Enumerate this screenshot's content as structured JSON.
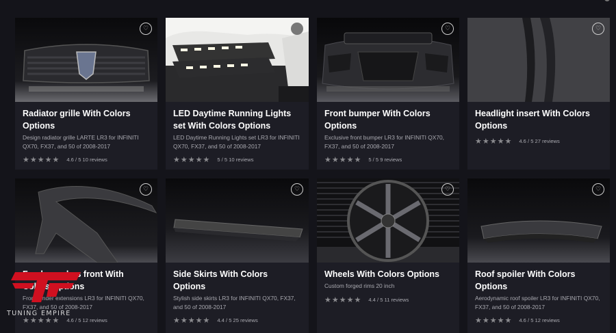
{
  "products": [
    {
      "title": "Radiator grille With Colors Options",
      "desc": "Design radiator grille LARTE LR3 for INFINITI QX70, FX37, and 50 of 2008-2017",
      "stars": "★★★★★",
      "rating": "4.6 / 5 10 reviews"
    },
    {
      "title": "LED Daytime Running Lights set With Colors Options",
      "desc": "LED Daytime Running Lights set LR3 for INFINITI QX70, FX37, and 50 of 2008-2017",
      "stars": "★★★★★",
      "rating": "5 / 5 10 reviews"
    },
    {
      "title": "Front bumper With Colors Options",
      "desc": "Exclusive front bumper LR3 for INFINITI QX70, FX37, and 50 of 2008-2017",
      "stars": "★★★★★",
      "rating": "5 / 5 9 reviews"
    },
    {
      "title": "Headlight insert With Colors Options",
      "desc": "",
      "stars": "★★★★★",
      "rating": "4.6 / 5 27 reviews"
    },
    {
      "title": "Fender arches front With Colors Options",
      "desc": "Front fender extensions LR3 for INFINITI QX70, FX37, and 50 of 2008-2017",
      "stars": "★★★★★",
      "rating": "4.6 / 5 12 reviews"
    },
    {
      "title": "Side Skirts With Colors Options",
      "desc": "Stylish side skirts LR3 for INFINITI QX70, FX37, and 50 of 2008-2017",
      "stars": "★★★★★",
      "rating": "4.4 / 5 25 reviews"
    },
    {
      "title": "Wheels With Colors Options",
      "desc": "Custom forged rims 20 inch",
      "stars": "★★★★★",
      "rating": "4.4 / 5 11 reviews"
    },
    {
      "title": "Roof spoiler With Colors Options",
      "desc": "Aerodynamic roof spoiler LR3 for INFINITI QX70, FX37, and 50 of 2008-2017",
      "stars": "★★★★★",
      "rating": "4.6 / 5 12 reviews"
    }
  ],
  "icons": {
    "favorite": "heart-icon"
  },
  "brand": {
    "name": "TUNING EMPIRE",
    "accent": "#d01020"
  }
}
